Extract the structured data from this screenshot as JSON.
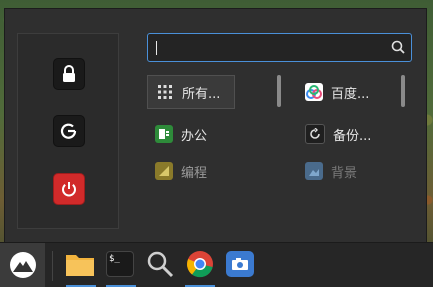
{
  "search": {
    "value": "",
    "placeholder": ""
  },
  "apps": {
    "left": [
      {
        "label": "所有...",
        "icon": "grid-icon",
        "selected": true
      },
      {
        "label": "办公",
        "icon": "office-icon"
      },
      {
        "label": "编程",
        "icon": "programming-icon"
      }
    ],
    "right": [
      {
        "label": "百度...",
        "icon": "baidu-netdisk-icon"
      },
      {
        "label": "备份...",
        "icon": "backup-icon"
      },
      {
        "label": "背景",
        "icon": "wallpaper-icon"
      }
    ]
  },
  "session_actions": [
    "lock-icon",
    "logout-icon",
    "power-icon"
  ],
  "taskbar": {
    "apps": [
      "file-manager-icon",
      "terminal-icon",
      "search-icon",
      "chrome-icon",
      "screenshot-icon"
    ],
    "terminal_glyph": "$_"
  },
  "colors": {
    "accent": "#4a90d9",
    "power": "#d12a2a",
    "menu_bg": "#2f2f2f"
  }
}
